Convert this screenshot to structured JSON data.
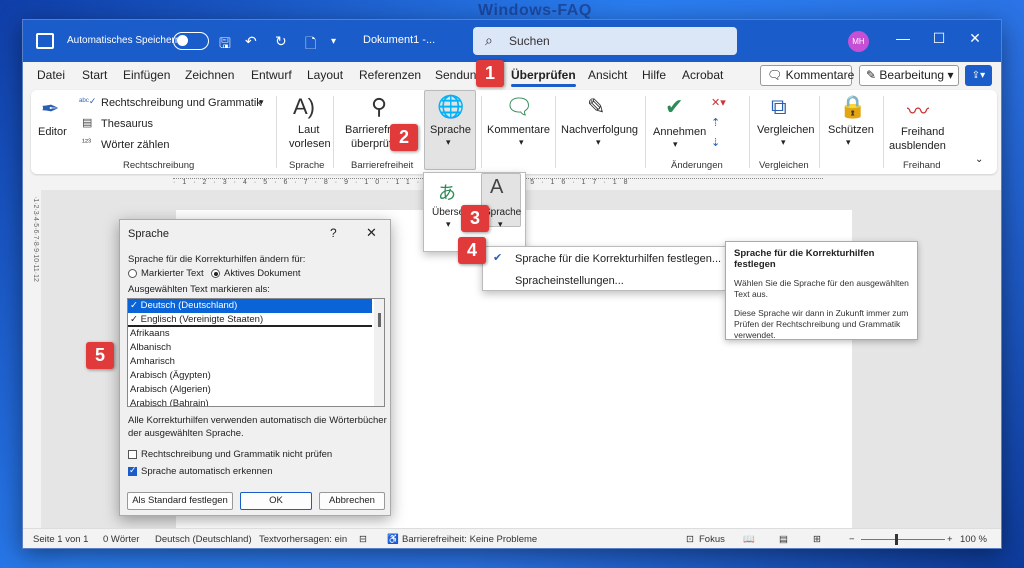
{
  "watermark": "Windows-FAQ",
  "titlebar": {
    "autosave_label": "Automatisches Speichern",
    "document_title": "Dokument1 -...",
    "search_placeholder": "Suchen",
    "avatar_initials": "MH"
  },
  "menu": {
    "tabs": [
      "Datei",
      "Start",
      "Einfügen",
      "Zeichnen",
      "Entwurf",
      "Layout",
      "Referenzen",
      "Sendun",
      "Überprüfen",
      "Ansicht",
      "Hilfe",
      "Acrobat"
    ],
    "active_tab": "Überprüfen",
    "kommentare_button": "Kommentare",
    "bearbeitung_button": "Bearbeitung"
  },
  "ribbon": {
    "editor": "Editor",
    "spelling": "Rechtschreibung und Grammatik",
    "thesaurus": "Thesaurus",
    "word_count": "Wörter zählen",
    "group_proofing": "Rechtschreibung",
    "read_aloud_1": "Laut",
    "read_aloud_2": "vorlesen",
    "group_speech": "Sprache",
    "accessibility_1": "Barrierefrei",
    "accessibility_2": "überprüf",
    "group_accessibility": "Barrierefreiheit",
    "language_button": "Sprache",
    "comments_button": "Kommentare",
    "tracking_button": "Nachverfolgung",
    "accept_button": "Annehmen",
    "group_changes": "Änderungen",
    "compare_button": "Vergleichen",
    "group_compare": "Vergleichen",
    "protect_button": "Schützen",
    "ink_hide_1": "Freihand",
    "ink_hide_2": "ausblenden",
    "group_ink": "Freihand"
  },
  "language_dropdown": {
    "translate": "Übersetz",
    "language": "Sprache"
  },
  "language_submenu": {
    "set_proofing": "Sprache für die Korrekturhilfen festlegen...",
    "language_settings": "Spracheinstellungen..."
  },
  "tooltip": {
    "title": "Sprache für die Korrekturhilfen festlegen",
    "body1": "Wählen Sie die Sprache für den ausgewählten Text aus.",
    "body2": "Diese Sprache wir dann in Zukunft immer zum Prüfen der Rechtschreibung und Grammatik verwendet."
  },
  "dialog": {
    "title": "Sprache",
    "help": "?",
    "change_for_label": "Sprache für die Korrekturhilfen ändern für:",
    "radio_selected_text": "Markierter Text",
    "radio_active_doc": "Aktives Dokument",
    "mark_as_label": "Ausgewählten Text markieren als:",
    "languages": [
      "Deutsch (Deutschland)",
      "Englisch (Vereinigte Staaten)",
      "Afrikaans",
      "Albanisch",
      "Amharisch",
      "Arabisch (Ägypten)",
      "Arabisch (Algerien)",
      "Arabisch (Bahrain)"
    ],
    "selected_language": "Deutsch (Deutschland)",
    "info_line1": "Alle Korrekturhilfen verwenden automatisch die Wörterbücher",
    "info_line2": "der ausgewählten Sprache.",
    "check_no_proof": "Rechtschreibung und Grammatik nicht prüfen",
    "check_no_proof_checked": false,
    "check_auto_detect": "Sprache automatisch erkennen",
    "check_auto_detect_checked": true,
    "btn_default": "Als Standard festlegen",
    "btn_ok": "OK",
    "btn_cancel": "Abbrechen"
  },
  "badges": [
    "1",
    "2",
    "3",
    "4",
    "5"
  ],
  "statusbar": {
    "page": "Seite 1 von 1",
    "words": "0 Wörter",
    "language": "Deutsch (Deutschland)",
    "text_predictions": "Textvorhersagen: ein",
    "accessibility": "Barrierefreiheit: Keine Probleme",
    "focus": "Fokus",
    "zoom": "100 %"
  },
  "colors": {
    "accent": "#1a5cc9",
    "badge": "#e03a3a",
    "selection": "#0a64d8"
  }
}
